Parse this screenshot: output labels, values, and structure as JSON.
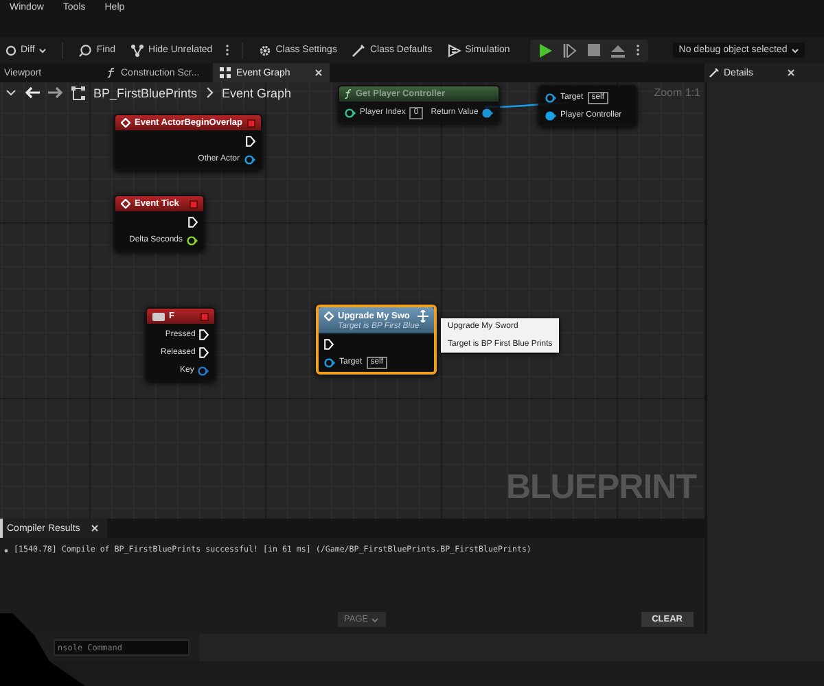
{
  "menu": [
    "Window",
    "Tools",
    "Help"
  ],
  "toolbar": {
    "diff": "Diff",
    "items": [
      {
        "kind": "find",
        "label": "Find"
      },
      {
        "kind": "hide",
        "label": "Hide Unrelated"
      },
      {
        "kind": "more"
      },
      {
        "kind": "settings",
        "label": "Class Settings"
      },
      {
        "kind": "defaults",
        "label": "Class Defaults"
      },
      {
        "kind": "simulation",
        "label": "Simulation"
      }
    ],
    "play": [
      {
        "kind": "play"
      },
      {
        "kind": "step"
      },
      {
        "kind": "stop"
      },
      {
        "kind": "eject"
      },
      {
        "kind": "more"
      }
    ],
    "debug": "No debug object selected"
  },
  "tabs": [
    {
      "kind": "viewport",
      "label": "Viewport",
      "selected": false,
      "closable": false
    },
    {
      "kind": "function",
      "label": "Construction Scr...",
      "selected": false,
      "closable": false
    },
    {
      "kind": "graph",
      "label": "Event Graph",
      "selected": true,
      "closable": true
    }
  ],
  "breadcrumb": {
    "blueprint": "BP_FirstBluePrints",
    "graph": "Event Graph"
  },
  "zoom": "Zoom 1:1",
  "nodes": [
    {
      "kind": "pure",
      "title": "Get Player Controller",
      "selected": false,
      "inputs": [
        {
          "kind": "int",
          "label": "Player Index",
          "value": "0",
          "connected": false
        }
      ],
      "outputs": [
        {
          "kind": "object",
          "label": "Return Value",
          "connected": true
        }
      ]
    },
    {
      "kind": "headless",
      "selected": false,
      "inputs": [
        {
          "kind": "object",
          "label": "Target",
          "value": "self",
          "connected": false
        },
        {
          "kind": "object",
          "label": "Player Controller",
          "connected": true
        }
      ]
    },
    {
      "kind": "event",
      "title": "Event ActorBeginOverlap",
      "selected": false,
      "outputs": [
        {
          "kind": "exec",
          "connected": false
        },
        {
          "kind": "object",
          "label": "Other Actor",
          "connected": false
        }
      ]
    },
    {
      "kind": "event",
      "title": "Event Tick",
      "selected": false,
      "outputs": [
        {
          "kind": "exec",
          "connected": false
        },
        {
          "kind": "float",
          "label": "Delta Seconds",
          "connected": false
        }
      ]
    },
    {
      "kind": "input",
      "title": "F",
      "selected": false,
      "outputs": [
        {
          "kind": "exec",
          "label": "Pressed",
          "connected": false
        },
        {
          "kind": "exec",
          "label": "Released",
          "connected": false
        },
        {
          "kind": "struct",
          "label": "Key",
          "connected": false
        }
      ]
    },
    {
      "kind": "function",
      "title": "Upgrade My Swo",
      "subtitle": "Target is BP First Blue",
      "selected": true,
      "inputs": [
        {
          "kind": "exec",
          "connected": false
        },
        {
          "kind": "object",
          "label": "Target",
          "value": "self",
          "connected": false
        }
      ]
    }
  ],
  "tooltip": [
    "Upgrade My Sword",
    "Target is BP First Blue Prints"
  ],
  "watermark": "BLUEPRINT",
  "details": {
    "label": "Details",
    "selected": false
  },
  "compiler": {
    "tab": "Compiler Results",
    "lines": [
      "[1540.78] Compile of BP_FirstBluePrints successful! [in 61 ms] (/Game/BP_FirstBluePrints.BP_FirstBluePrints)"
    ],
    "page": {
      "label": "PAGE",
      "disabled": true
    },
    "clear": "CLEAR"
  },
  "console": {
    "placeholder": "nsole Command"
  }
}
